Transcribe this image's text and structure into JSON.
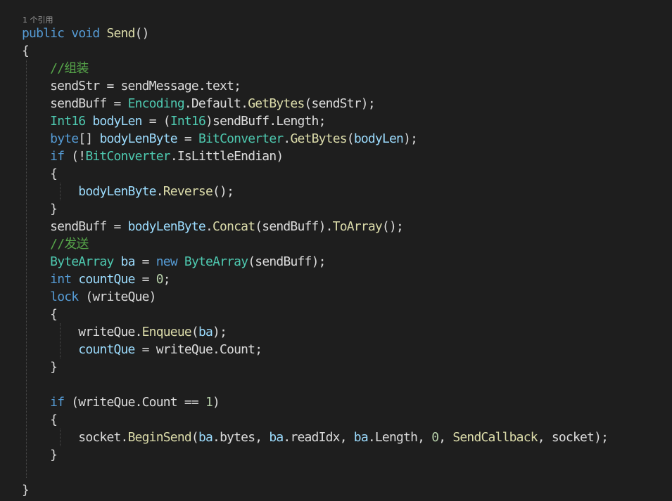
{
  "codelens": {
    "references": "1 个引用"
  },
  "colors": {
    "background": "#1e1e1e",
    "plain": "#dcdcdc",
    "keyword": "#569cd6",
    "type": "#4ec9b0",
    "method": "#dcdcaa",
    "local": "#9cdcfe",
    "number": "#b5cea8",
    "comment": "#57a64a"
  },
  "code": {
    "lines": [
      {
        "tokens": [
          {
            "t": "public",
            "c": "kw"
          },
          {
            "t": " ",
            "c": "plain"
          },
          {
            "t": "void",
            "c": "kw"
          },
          {
            "t": " ",
            "c": "plain"
          },
          {
            "t": "Send",
            "c": "method"
          },
          {
            "t": "()",
            "c": "plain"
          }
        ]
      },
      {
        "tokens": [
          {
            "t": "{",
            "c": "plain"
          }
        ]
      },
      {
        "tokens": [
          {
            "t": "    ",
            "c": "plain"
          },
          {
            "t": "//组装",
            "c": "comment"
          }
        ]
      },
      {
        "tokens": [
          {
            "t": "    sendStr = sendMessage.text;",
            "c": "plain"
          }
        ]
      },
      {
        "tokens": [
          {
            "t": "    sendBuff = ",
            "c": "plain"
          },
          {
            "t": "Encoding",
            "c": "type"
          },
          {
            "t": ".Default.",
            "c": "plain"
          },
          {
            "t": "GetBytes",
            "c": "method"
          },
          {
            "t": "(sendStr);",
            "c": "plain"
          }
        ]
      },
      {
        "tokens": [
          {
            "t": "    ",
            "c": "plain"
          },
          {
            "t": "Int16",
            "c": "type"
          },
          {
            "t": " ",
            "c": "plain"
          },
          {
            "t": "bodyLen",
            "c": "local"
          },
          {
            "t": " = (",
            "c": "plain"
          },
          {
            "t": "Int16",
            "c": "type"
          },
          {
            "t": ")sendBuff.Length;",
            "c": "plain"
          }
        ]
      },
      {
        "tokens": [
          {
            "t": "    ",
            "c": "plain"
          },
          {
            "t": "byte",
            "c": "kw"
          },
          {
            "t": "[] ",
            "c": "plain"
          },
          {
            "t": "bodyLenByte",
            "c": "local"
          },
          {
            "t": " = ",
            "c": "plain"
          },
          {
            "t": "BitConverter",
            "c": "type"
          },
          {
            "t": ".",
            "c": "plain"
          },
          {
            "t": "GetBytes",
            "c": "method"
          },
          {
            "t": "(",
            "c": "plain"
          },
          {
            "t": "bodyLen",
            "c": "local"
          },
          {
            "t": ");",
            "c": "plain"
          }
        ]
      },
      {
        "tokens": [
          {
            "t": "    ",
            "c": "plain"
          },
          {
            "t": "if",
            "c": "kw"
          },
          {
            "t": " (!",
            "c": "plain"
          },
          {
            "t": "BitConverter",
            "c": "type"
          },
          {
            "t": ".IsLittleEndian)",
            "c": "plain"
          }
        ]
      },
      {
        "tokens": [
          {
            "t": "    {",
            "c": "plain"
          }
        ]
      },
      {
        "tokens": [
          {
            "t": "        ",
            "c": "plain"
          },
          {
            "t": "bodyLenByte",
            "c": "local"
          },
          {
            "t": ".",
            "c": "plain"
          },
          {
            "t": "Reverse",
            "c": "method"
          },
          {
            "t": "();",
            "c": "plain"
          }
        ]
      },
      {
        "tokens": [
          {
            "t": "    }",
            "c": "plain"
          }
        ]
      },
      {
        "tokens": [
          {
            "t": "    sendBuff = ",
            "c": "plain"
          },
          {
            "t": "bodyLenByte",
            "c": "local"
          },
          {
            "t": ".",
            "c": "plain"
          },
          {
            "t": "Concat",
            "c": "method"
          },
          {
            "t": "(sendBuff).",
            "c": "plain"
          },
          {
            "t": "ToArray",
            "c": "method"
          },
          {
            "t": "();",
            "c": "plain"
          }
        ]
      },
      {
        "tokens": [
          {
            "t": "    ",
            "c": "plain"
          },
          {
            "t": "//发送",
            "c": "comment"
          }
        ]
      },
      {
        "tokens": [
          {
            "t": "    ",
            "c": "plain"
          },
          {
            "t": "ByteArray",
            "c": "type"
          },
          {
            "t": " ",
            "c": "plain"
          },
          {
            "t": "ba",
            "c": "local"
          },
          {
            "t": " = ",
            "c": "plain"
          },
          {
            "t": "new",
            "c": "kw"
          },
          {
            "t": " ",
            "c": "plain"
          },
          {
            "t": "ByteArray",
            "c": "type"
          },
          {
            "t": "(sendBuff);",
            "c": "plain"
          }
        ]
      },
      {
        "tokens": [
          {
            "t": "    ",
            "c": "plain"
          },
          {
            "t": "int",
            "c": "kw"
          },
          {
            "t": " ",
            "c": "plain"
          },
          {
            "t": "countQue",
            "c": "local"
          },
          {
            "t": " = ",
            "c": "plain"
          },
          {
            "t": "0",
            "c": "num"
          },
          {
            "t": ";",
            "c": "plain"
          }
        ]
      },
      {
        "tokens": [
          {
            "t": "    ",
            "c": "plain"
          },
          {
            "t": "lock",
            "c": "kw"
          },
          {
            "t": " (writeQue)",
            "c": "plain"
          }
        ]
      },
      {
        "tokens": [
          {
            "t": "    {",
            "c": "plain"
          }
        ]
      },
      {
        "tokens": [
          {
            "t": "        writeQue.",
            "c": "plain"
          },
          {
            "t": "Enqueue",
            "c": "method"
          },
          {
            "t": "(",
            "c": "plain"
          },
          {
            "t": "ba",
            "c": "local"
          },
          {
            "t": ");",
            "c": "plain"
          }
        ]
      },
      {
        "tokens": [
          {
            "t": "        ",
            "c": "plain"
          },
          {
            "t": "countQue",
            "c": "local"
          },
          {
            "t": " = writeQue.Count;",
            "c": "plain"
          }
        ]
      },
      {
        "tokens": [
          {
            "t": "    }",
            "c": "plain"
          }
        ]
      },
      {
        "tokens": [
          {
            "t": "",
            "c": "plain"
          }
        ]
      },
      {
        "tokens": [
          {
            "t": "    ",
            "c": "plain"
          },
          {
            "t": "if",
            "c": "kw"
          },
          {
            "t": " (writeQue.Count == ",
            "c": "plain"
          },
          {
            "t": "1",
            "c": "num"
          },
          {
            "t": ")",
            "c": "plain"
          }
        ]
      },
      {
        "tokens": [
          {
            "t": "    {",
            "c": "plain"
          }
        ]
      },
      {
        "tokens": [
          {
            "t": "        socket.",
            "c": "plain"
          },
          {
            "t": "BeginSend",
            "c": "method"
          },
          {
            "t": "(",
            "c": "plain"
          },
          {
            "t": "ba",
            "c": "local"
          },
          {
            "t": ".bytes, ",
            "c": "plain"
          },
          {
            "t": "ba",
            "c": "local"
          },
          {
            "t": ".readIdx, ",
            "c": "plain"
          },
          {
            "t": "ba",
            "c": "local"
          },
          {
            "t": ".Length, ",
            "c": "plain"
          },
          {
            "t": "0",
            "c": "num"
          },
          {
            "t": ", ",
            "c": "plain"
          },
          {
            "t": "SendCallback",
            "c": "method"
          },
          {
            "t": ", socket);",
            "c": "plain"
          }
        ]
      },
      {
        "tokens": [
          {
            "t": "    }",
            "c": "plain"
          }
        ]
      },
      {
        "tokens": [
          {
            "t": "",
            "c": "plain"
          }
        ]
      },
      {
        "tokens": [
          {
            "t": "}",
            "c": "plain"
          }
        ]
      }
    ]
  }
}
